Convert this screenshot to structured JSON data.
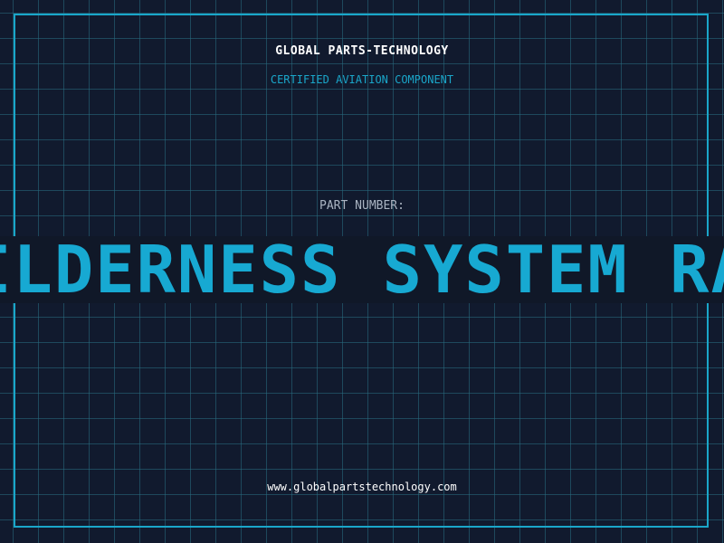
{
  "header": {
    "company": "GLOBAL PARTS-TECHNOLOGY",
    "subtitle": "CERTIFIED AVIATION COMPONENT"
  },
  "part": {
    "label": "PART NUMBER:",
    "value": "WILDERNESS SYSTEM RAV"
  },
  "footer": {
    "website": "www.globalpartstechnology.com"
  },
  "colors": {
    "background": "#111a2e",
    "grid": "#286e82",
    "accent": "#1aa6c9",
    "text": "#ffffff",
    "muted": "#aab4c2"
  }
}
